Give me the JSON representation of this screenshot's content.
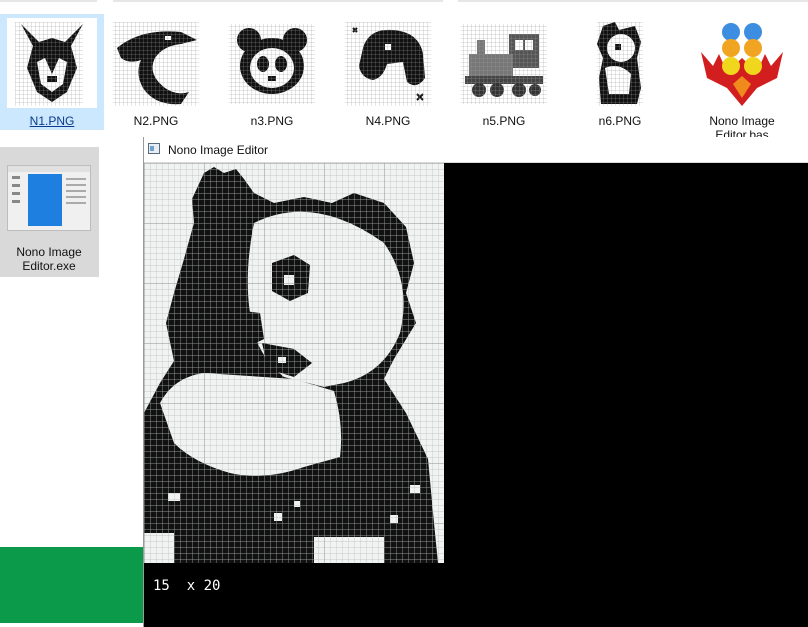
{
  "desktop": {
    "files": [
      {
        "label": "N1.PNG",
        "icon": "husky-nonogram-icon",
        "selected": true
      },
      {
        "label": "N2.PNG",
        "icon": "dolphin-nonogram-icon",
        "selected": false
      },
      {
        "label": "n3.PNG",
        "icon": "panda-face-nonogram-icon",
        "selected": false
      },
      {
        "label": "N4.PNG",
        "icon": "dog-nonogram-icon",
        "selected": false
      },
      {
        "label": "n5.PNG",
        "icon": "train-nonogram-icon",
        "selected": false
      },
      {
        "label": "n6.PNG",
        "icon": "panda-sitting-nonogram-icon",
        "selected": false
      },
      {
        "label": "Nono Image Editor.bas",
        "icon": "qb64pe-phoenix-icon",
        "selected": false
      }
    ],
    "exe": {
      "label": "Nono Image Editor.exe",
      "icon": "editor-app-icon"
    }
  },
  "window": {
    "title": "Nono Image Editor",
    "status_text": "15  x 20"
  },
  "colors": {
    "selection": "#cce8ff",
    "exe_selection": "#d9d9d9",
    "taskbar_green": "#0a9a4a",
    "window_background": "#000000",
    "canvas_background": "#f1f3f3"
  }
}
